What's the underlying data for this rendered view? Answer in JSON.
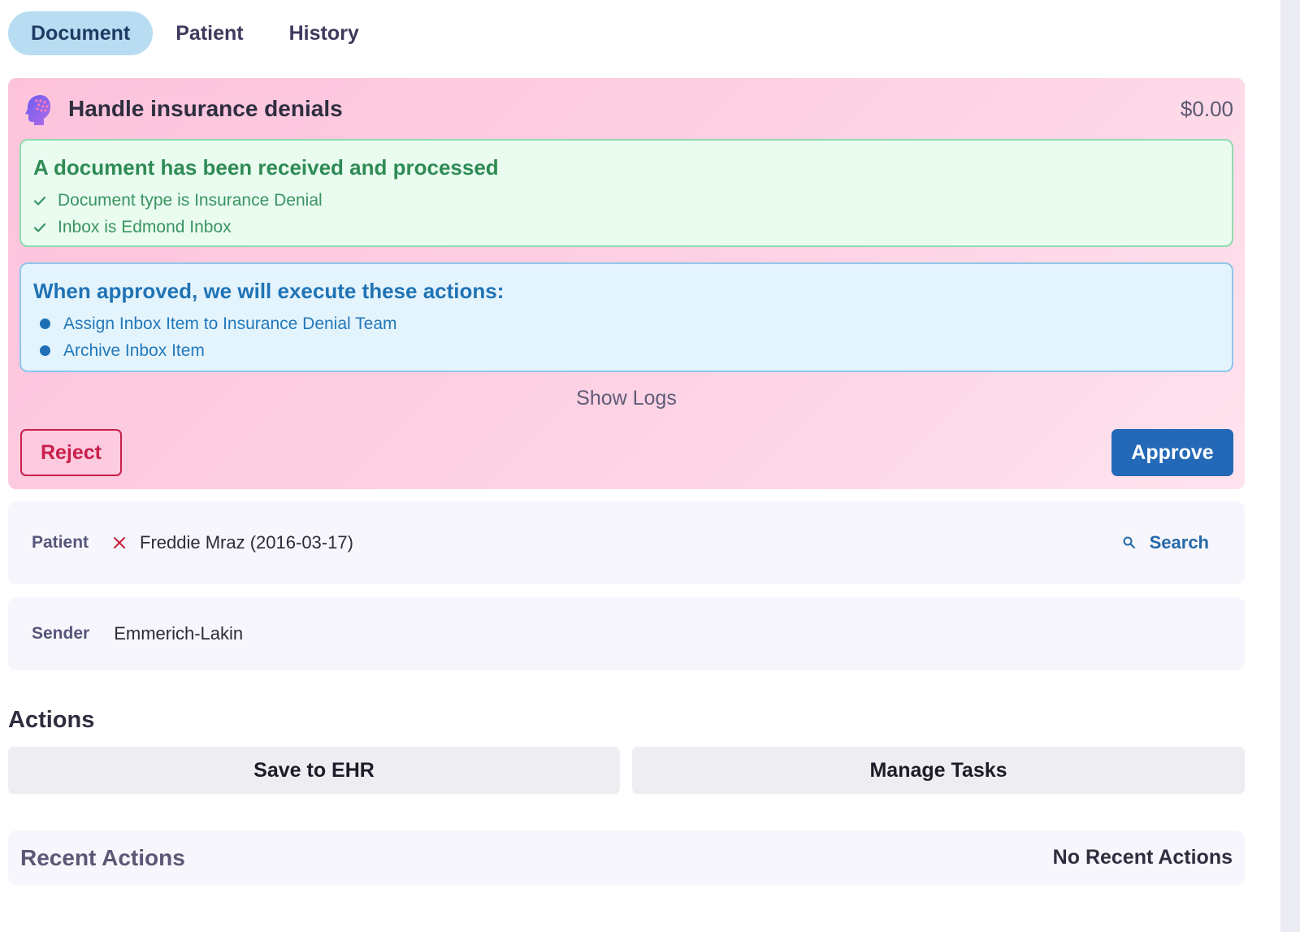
{
  "tabs": [
    {
      "label": "Document",
      "active": true
    },
    {
      "label": "Patient",
      "active": false
    },
    {
      "label": "History",
      "active": false
    }
  ],
  "agent": {
    "icon": "brain-head-icon",
    "title": "Handle insurance denials",
    "cost": "$0.00",
    "processed": {
      "title": "A document has been received and processed",
      "items": [
        "Document type is Insurance Denial",
        "Inbox is Edmond Inbox"
      ]
    },
    "pending": {
      "title": "When approved, we will execute these actions:",
      "items": [
        "Assign Inbox Item to Insurance Denial Team",
        "Archive Inbox Item"
      ]
    },
    "show_logs": "Show Logs",
    "reject_label": "Reject",
    "approve_label": "Approve"
  },
  "patient": {
    "label": "Patient",
    "value": "Freddie Mraz (2016-03-17)",
    "search_label": "Search"
  },
  "sender": {
    "label": "Sender",
    "value": "Emmerich-Lakin"
  },
  "actions": {
    "heading": "Actions",
    "buttons": [
      "Save to EHR",
      "Manage Tasks"
    ]
  },
  "recent": {
    "title": "Recent Actions",
    "status": "No Recent Actions"
  },
  "colors": {
    "tab_active_bg": "#b8dcf2",
    "success": "#2f8b55",
    "info": "#1f73b5",
    "danger": "#c81f4a",
    "primary": "#2469b8"
  }
}
